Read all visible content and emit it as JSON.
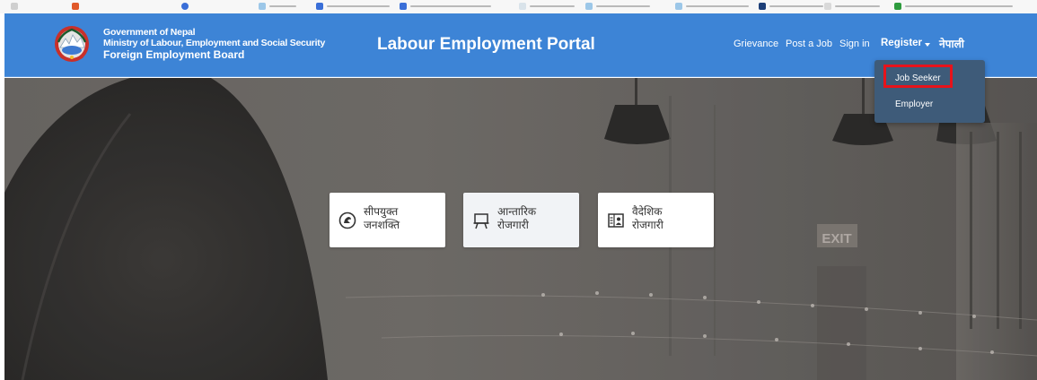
{
  "header": {
    "org_line1": "Government of Nepal",
    "org_line2": "Ministry of Labour, Employment and Social Security",
    "org_line3": "Foreign Employment Board",
    "portal_title": "Labour Employment Portal",
    "bg_color": "#3d84d6"
  },
  "nav": {
    "grievance": "Grievance",
    "post_job": "Post a Job",
    "sign_in": "Sign in",
    "register": "Register",
    "language": "नेपाली"
  },
  "register_menu": {
    "items": [
      "Job Seeker",
      "Employer"
    ],
    "highlighted": "Job Seeker",
    "highlight_color": "#e8131b"
  },
  "services": [
    {
      "line1": "सीपयुक्त",
      "line2": "जनशक्ति",
      "icon": "skill-icon"
    },
    {
      "line1": "आन्तारिक",
      "line2": "रोजगारी",
      "icon": "easel-icon"
    },
    {
      "line1": "वैदेशिक",
      "line2": "रोजगारी",
      "icon": "id-card-icon"
    }
  ],
  "hero": {
    "exit_sign": "EXIT"
  }
}
